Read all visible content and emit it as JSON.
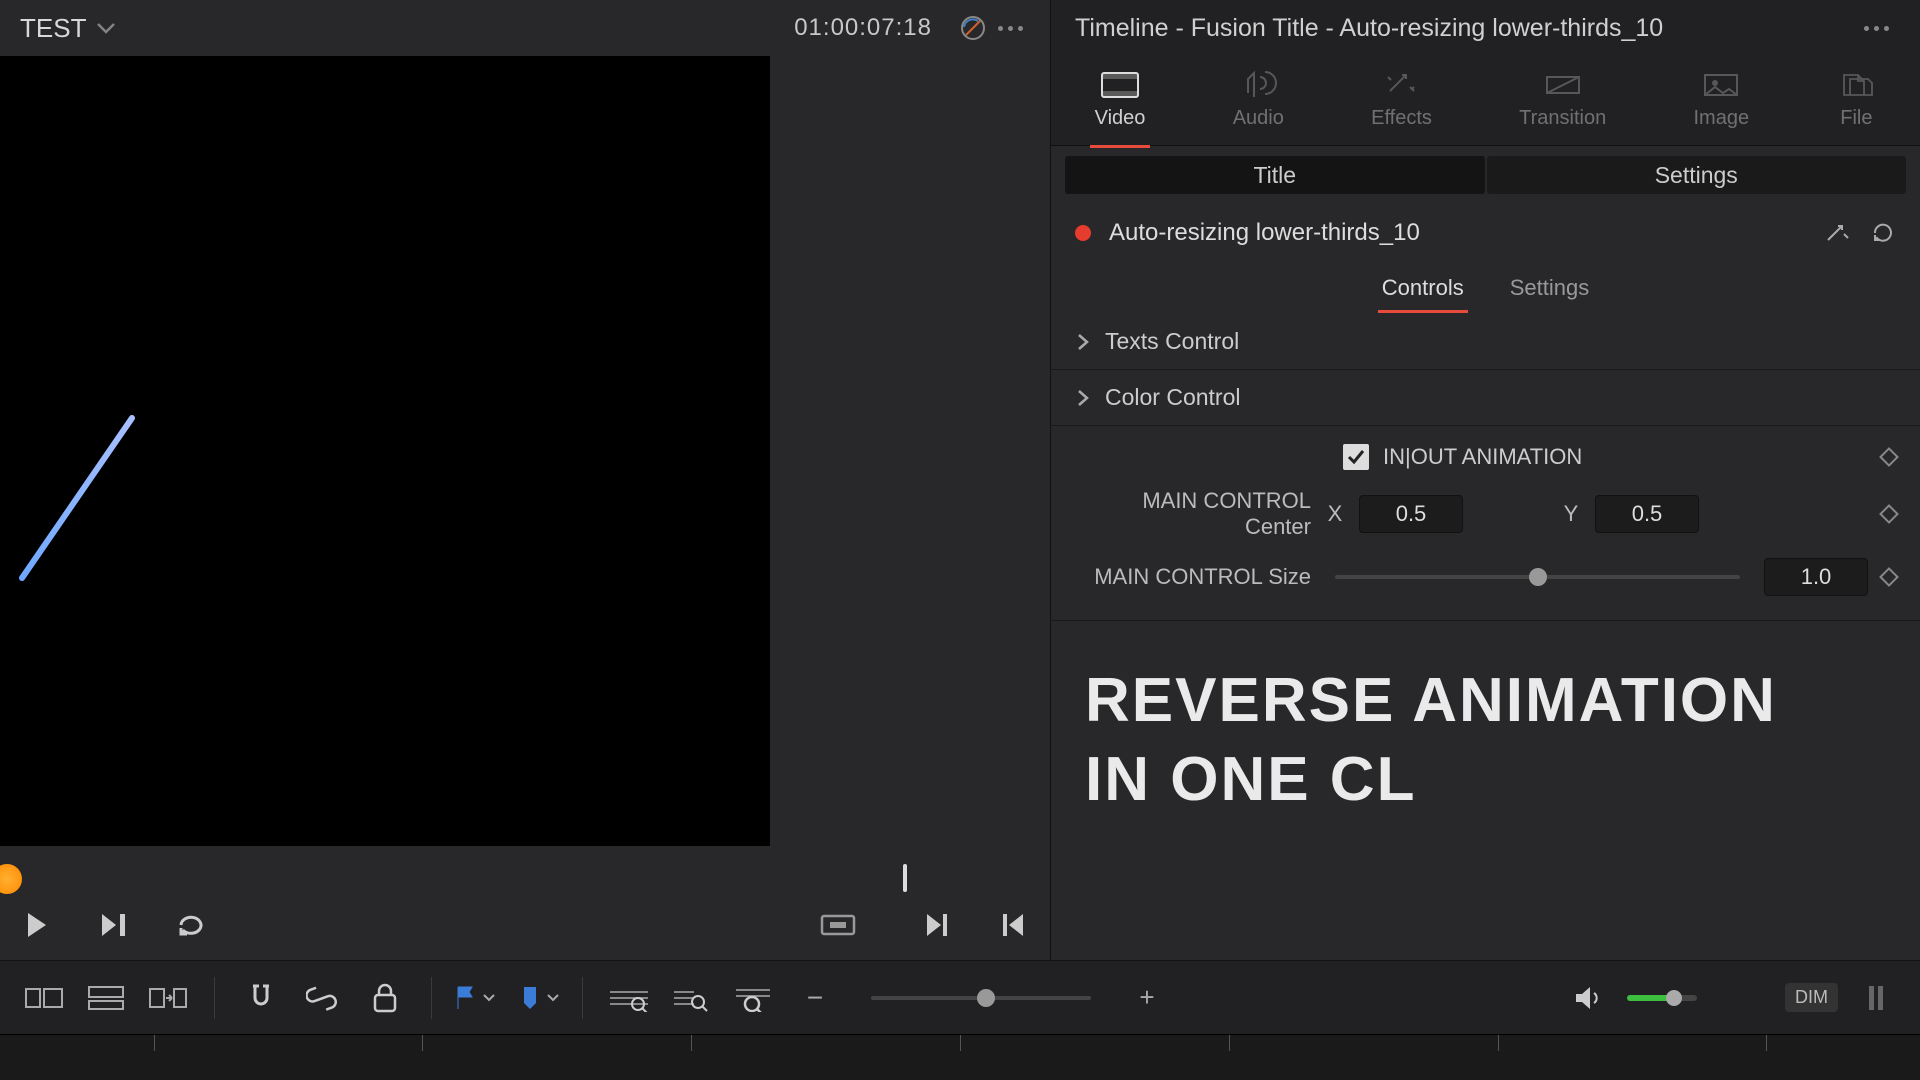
{
  "viewer": {
    "clip_name": "TEST",
    "timecode": "01:00:07:18"
  },
  "inspector": {
    "title": "Timeline - Fusion Title - Auto-resizing lower-thirds_10",
    "tabs": {
      "video": "Video",
      "audio": "Audio",
      "effects": "Effects",
      "transition": "Transition",
      "image": "Image",
      "file": "File"
    },
    "subtabs": {
      "title": "Title",
      "settings": "Settings"
    },
    "node_name": "Auto-resizing lower-thirds_10",
    "mini_tabs": {
      "controls": "Controls",
      "settings": "Settings"
    },
    "sections": {
      "texts": "Texts Control",
      "color": "Color Control"
    },
    "anim_checkbox_label": "IN|OUT ANIMATION",
    "center_label": "MAIN CONTROL Center",
    "center_x": "0.5",
    "center_y": "0.5",
    "size_label": "MAIN CONTROL Size",
    "size_value": "1.0",
    "preview_line1": "REVERSE ANIMATION",
    "preview_line2": "IN ONE CL"
  },
  "toolbar": {
    "dim": "DIM",
    "x_label": "X",
    "y_label": "Y"
  }
}
